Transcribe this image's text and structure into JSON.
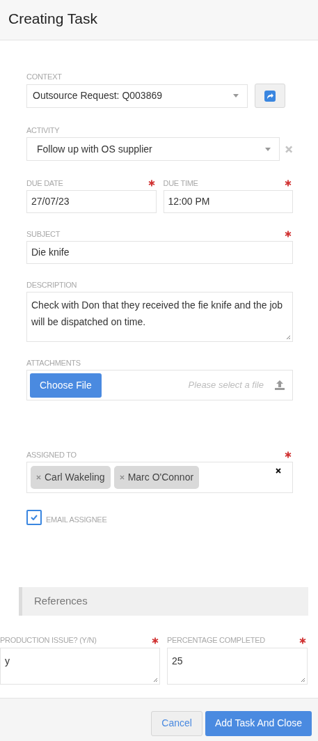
{
  "title": "Creating Task",
  "fields": [
    {
      "kind": "linkselect",
      "label": "CONTEXT",
      "value": "Outsource Request: Q003869",
      "required": false
    },
    {
      "kind": "clearselect",
      "label": "ACTIVITY",
      "value": "Follow up with OS supplier",
      "required": false
    },
    {
      "kind": "pair",
      "items": [
        {
          "label": "DUE DATE",
          "value": "27/07/23",
          "required": true
        },
        {
          "label": "DUE TIME",
          "value": "12:00 PM",
          "required": true
        }
      ]
    },
    {
      "kind": "input",
      "label": "SUBJECT",
      "value": "Die knife",
      "required": true
    },
    {
      "kind": "textarea",
      "label": "DESCRIPTION",
      "value": "Check with Don that they received the fie knife and the job will be dispatched on time.",
      "required": false
    },
    {
      "kind": "file",
      "label": "ATTACHMENTS",
      "button": "Choose File",
      "placeholder": "Please select a file",
      "required": false
    },
    {
      "kind": "tags",
      "label": "ASSIGNED TO",
      "tags": [
        "Carl Wakeling",
        "Marc O'Connor"
      ],
      "required": true
    },
    {
      "kind": "checkbox",
      "label": "EMAIL ASSIGNEE",
      "checked": true
    }
  ],
  "section": "References",
  "references": [
    {
      "label": "PRODUCTION ISSUE? (Y/N)",
      "value": "y",
      "required": true
    },
    {
      "label": "PERCENTAGE COMPLETED",
      "value": "25",
      "required": true
    }
  ],
  "buttons": [
    {
      "label": "Cancel",
      "primary": false
    },
    {
      "label": "Add Task And Close",
      "primary": true
    }
  ]
}
